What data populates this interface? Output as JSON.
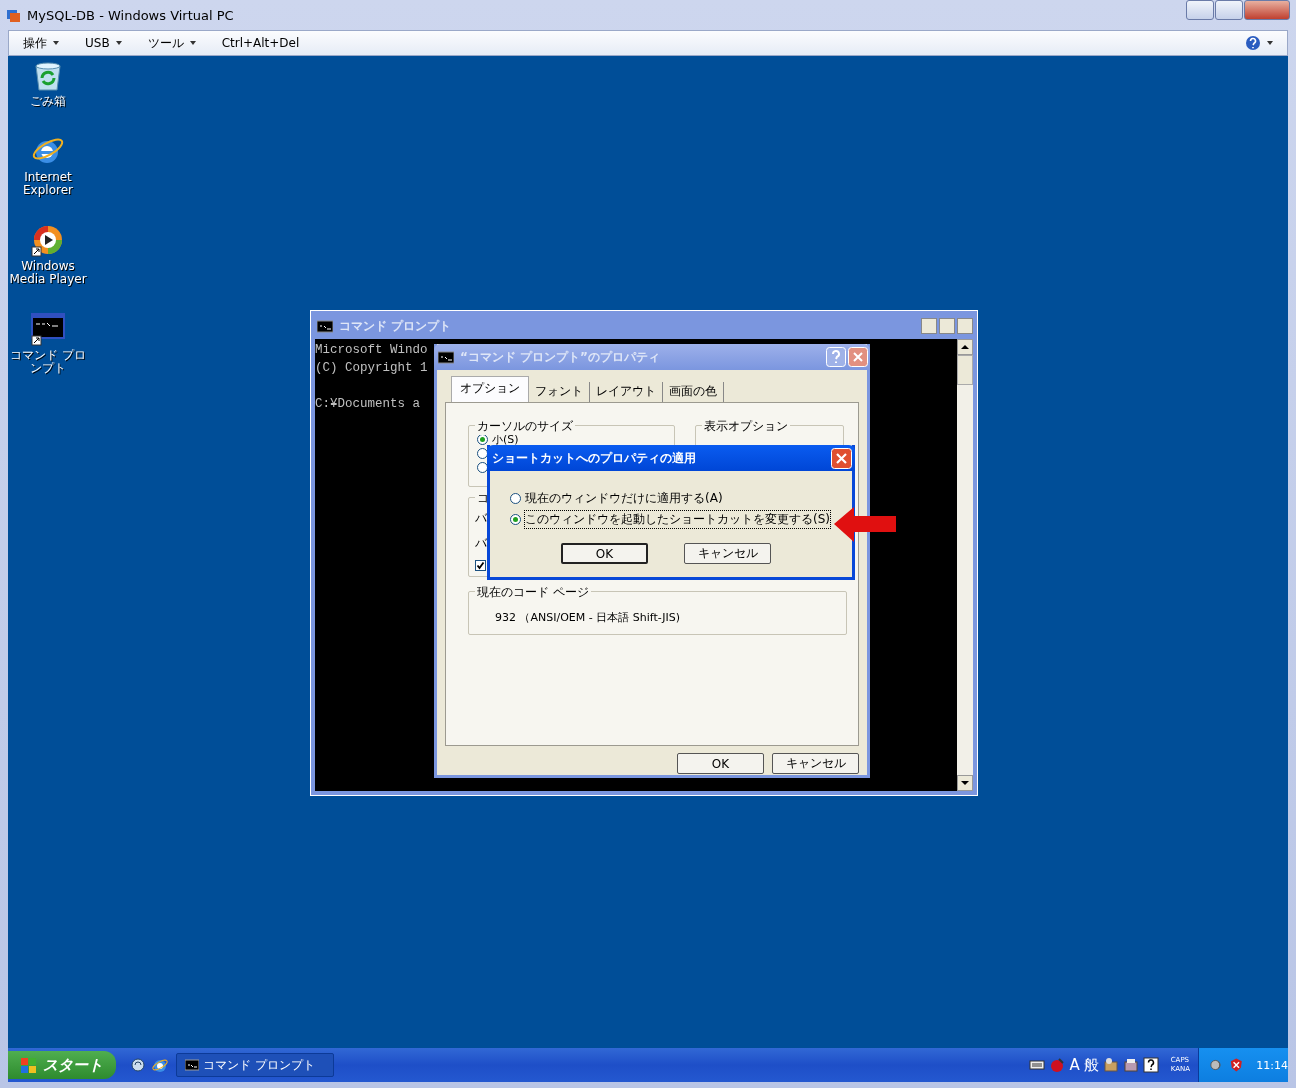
{
  "window": {
    "title": "MySQL-DB - Windows Virtual PC"
  },
  "menu": [
    {
      "label": "操作",
      "kind": "dropdown"
    },
    {
      "label": "USB",
      "kind": "dropdown"
    },
    {
      "label": "ツール",
      "kind": "dropdown"
    },
    {
      "label": "Ctrl+Alt+Del",
      "kind": "plain"
    }
  ],
  "desktop_icons": [
    {
      "label": "ごみ箱",
      "kind": "recycle"
    },
    {
      "label": "Internet Explorer",
      "kind": "browser"
    },
    {
      "label": "Windows Media Player",
      "kind": "media"
    },
    {
      "label": "コマンド プロンプト",
      "kind": "console"
    }
  ],
  "console_window": {
    "title": "コマンド プロンプト",
    "lines": [
      "Microsoft Windo",
      "(C) Copyright 1"
    ],
    "prompt": "C:¥Documents a"
  },
  "properties_dialog": {
    "title": "“コマンド プロンプト”のプロパティ",
    "tabs": [
      {
        "label": "オプション",
        "selected": true
      },
      {
        "label": "フォント",
        "selected": false
      },
      {
        "label": "レイアウト",
        "selected": false
      },
      {
        "label": "画面の色",
        "selected": false
      }
    ],
    "cursor_size": {
      "title": "カーソルのサイズ",
      "options": [
        {
          "label": "小(S)",
          "selected": true
        },
        {
          "selected": false
        },
        {
          "selected": false
        }
      ]
    },
    "display_options": {
      "title": "表示オプション"
    },
    "command_history": {
      "title": "コ",
      "rows": [
        "バ",
        "バ"
      ],
      "checked": true
    },
    "code_page": {
      "title": "現在のコード ページ",
      "value": "932 （ANSI/OEM - 日本語 Shift-JIS)"
    },
    "buttons": [
      "OK",
      "キャンセル"
    ]
  },
  "apply_dialog": {
    "title": "ショートカットへのプロパティの適用",
    "options": [
      {
        "label": "現在のウィンドウだけに適用する(A)",
        "selected": false
      },
      {
        "label": "このウィンドウを起動したショートカットを変更する(S)",
        "selected": true
      }
    ],
    "buttons": [
      "OK",
      "キャンセル"
    ]
  },
  "taskbar": {
    "start": "スタート",
    "tasks": [
      {
        "label": "コマンド プロンプト"
      }
    ],
    "ime_mode": "A",
    "ime_input": "般",
    "caps": "CAPS",
    "kana": "KANA",
    "clock": "11:14"
  }
}
